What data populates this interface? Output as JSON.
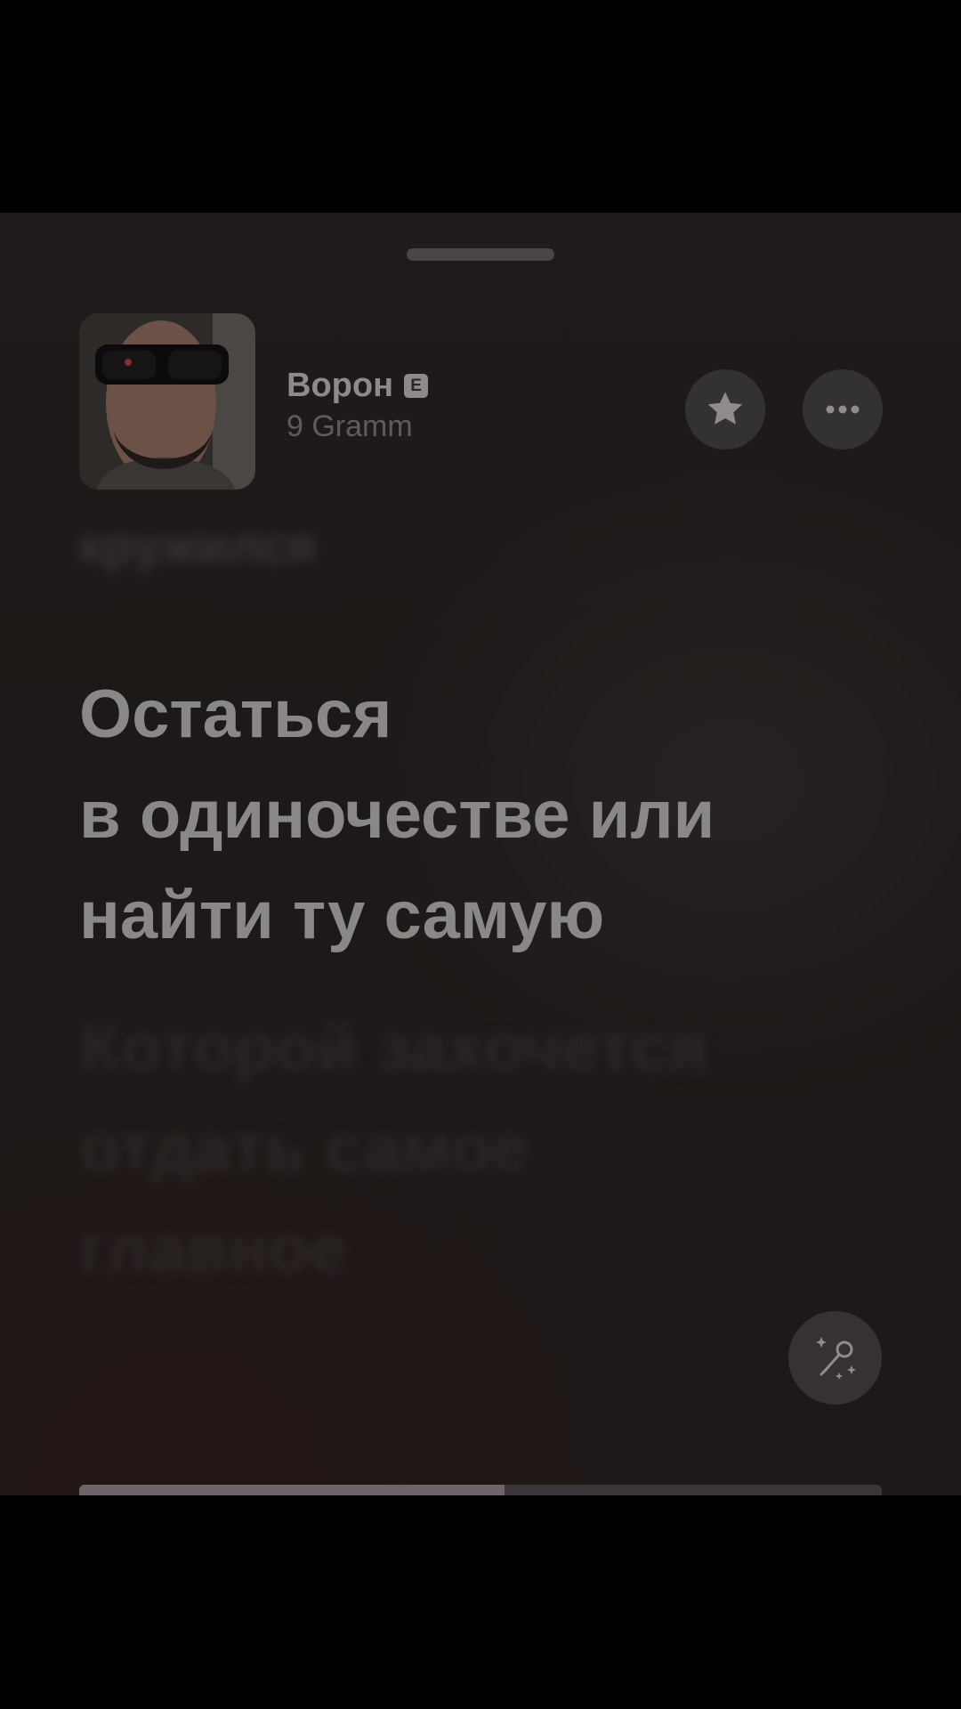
{
  "song": {
    "title": "Ворон",
    "explicit_badge": "E",
    "artist": "9 Gramm"
  },
  "actions": {
    "favorite_icon": "star-icon",
    "more_icon": "ellipsis-icon",
    "lyrics_mic_icon": "mic-sparkles-icon"
  },
  "lyrics": {
    "previous_line": "кружился",
    "current_lines": [
      "Остаться",
      "в одиночестве или",
      "найти ту самую"
    ],
    "next_lines": [
      "Которой захочется",
      "отдать самое",
      "главное"
    ]
  },
  "playback": {
    "progress": 0.53
  },
  "colors": {
    "background": "#1d1918",
    "current_lyric": "#8a8787",
    "progress_fill": "#6c6466",
    "progress_track": "#3a3536"
  }
}
